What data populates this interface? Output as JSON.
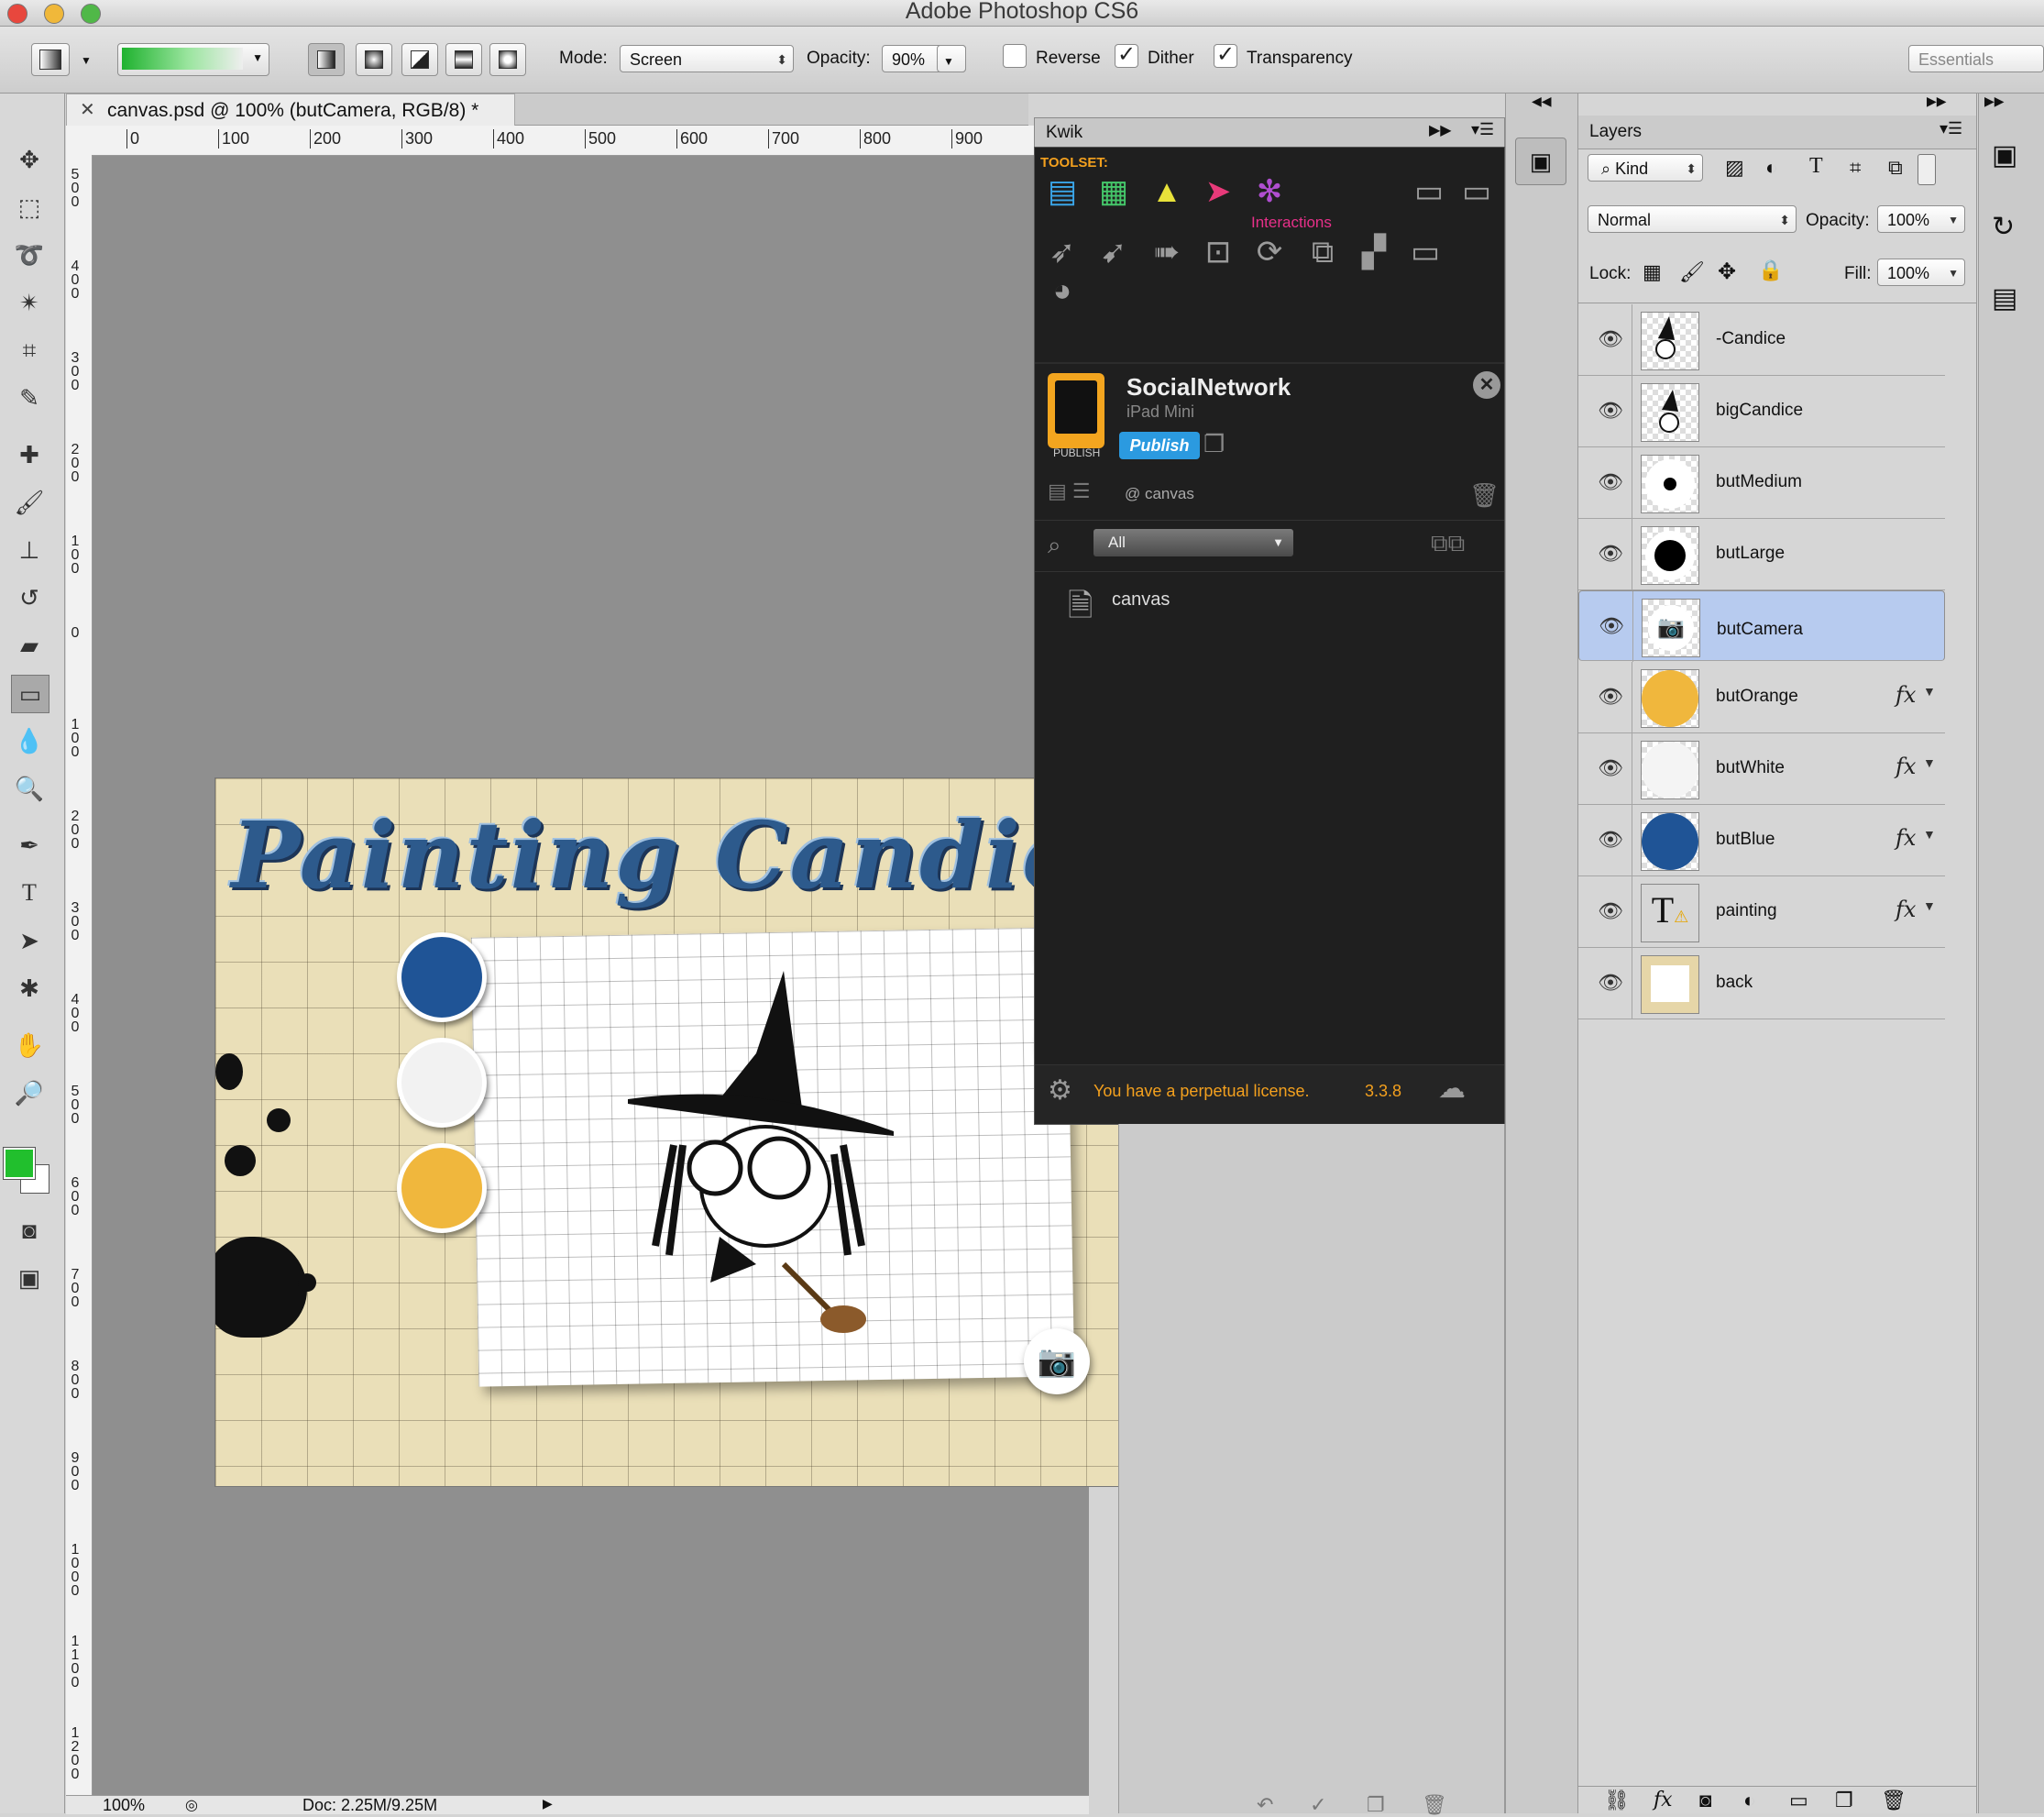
{
  "app": {
    "title": "Adobe Photoshop CS6"
  },
  "options": {
    "mode_label": "Mode:",
    "mode_value": "Screen",
    "opacity_label": "Opacity:",
    "opacity_value": "90%",
    "reverse_label": "Reverse",
    "dither_label": "Dither",
    "transparency_label": "Transparency",
    "workspace": "Essentials",
    "reverse_checked": false,
    "dither_checked": true,
    "transparency_checked": true,
    "gradient_colors": [
      "#1fb22f",
      "#ffffff"
    ]
  },
  "document": {
    "tab_title": "canvas.psd @ 100% (butCamera, RGB/8) *",
    "zoom": "100%",
    "doc_size": "Doc: 2.25M/9.25M",
    "ruler_h": [
      "0",
      "100",
      "200",
      "300",
      "400",
      "500",
      "600",
      "700",
      "800",
      "900"
    ],
    "ruler_v": [
      "500",
      "400",
      "300",
      "200",
      "100",
      "0",
      "100",
      "200",
      "300",
      "400",
      "500",
      "600",
      "700",
      "800",
      "900",
      "1000",
      "1100",
      "1200"
    ],
    "art_title": "Painting Candice",
    "swatch_colors": [
      "#1f5496",
      "#f2f2f2",
      "#f0b73d"
    ]
  },
  "kwik": {
    "panel_title": "Kwik",
    "toolset_label": "TOOLSET:",
    "interactions_label": "Interactions",
    "project_name": "SocialNetwork",
    "device": "iPad Mini",
    "publish_small": "PUBLISH",
    "publish_button": "Publish",
    "page_ref": "@ canvas",
    "filter_value": "All",
    "tree_item": "canvas",
    "license_text": "You have a perpetual license.",
    "version": "3.3.8"
  },
  "layers": {
    "panel_title": "Layers",
    "kind_filter": "Kind",
    "blend_mode": "Normal",
    "opacity_label": "Opacity:",
    "opacity_value": "100%",
    "lock_label": "Lock:",
    "fill_label": "Fill:",
    "fill_value": "100%",
    "items": [
      {
        "name": "-Candice",
        "fx": "",
        "selected": false
      },
      {
        "name": "bigCandice",
        "fx": "",
        "selected": false
      },
      {
        "name": "butMedium",
        "fx": "",
        "selected": false
      },
      {
        "name": "butLarge",
        "fx": "",
        "selected": false
      },
      {
        "name": "butCamera",
        "fx": "",
        "selected": true
      },
      {
        "name": "butOrange",
        "fx": "fx",
        "selected": false
      },
      {
        "name": "butWhite",
        "fx": "fx",
        "selected": false
      },
      {
        "name": "butBlue",
        "fx": "fx",
        "selected": false
      },
      {
        "name": "painting",
        "fx": "fx",
        "selected": false
      },
      {
        "name": "back",
        "fx": "",
        "selected": false
      }
    ]
  }
}
